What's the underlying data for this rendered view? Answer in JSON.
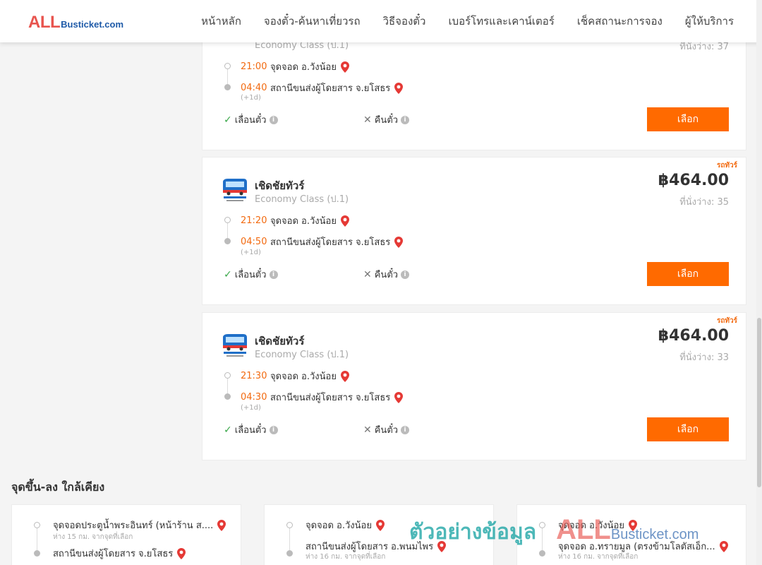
{
  "header": {
    "logo_all": "ALL",
    "logo_rest": "Busticket.com",
    "nav": [
      "หน้าหลัก",
      "จองตั๋ว-ค้นหาเที่ยวรถ",
      "วิธีจองตั๋ว",
      "เบอร์โทรและเคาน์เตอร์",
      "เช็คสถานะการจอง",
      "ผู้ให้บริการ"
    ]
  },
  "trips": [
    {
      "tag": "",
      "operator": "",
      "class": "Economy Class (ป.1)",
      "price": "",
      "seats": "ที่นั่งว่าง: 37",
      "depart_time": "21:00",
      "depart_place": "จุดจอด อ.วังน้อย",
      "arrive_time": "04:40",
      "arrive_place": "สถานีขนส่งผู้โดยสาร จ.ยโสธร",
      "plus_day": "(+1d)",
      "reschedule": "เลื่อนตั๋ว",
      "refund": "คืนตั๋ว",
      "select": "เลือก"
    },
    {
      "tag": "รถทัวร์",
      "operator": "เชิดชัยทัวร์",
      "class": "Economy Class (ป.1)",
      "price": "฿464.00",
      "seats": "ที่นั่งว่าง: 35",
      "depart_time": "21:20",
      "depart_place": "จุดจอด อ.วังน้อย",
      "arrive_time": "04:50",
      "arrive_place": "สถานีขนส่งผู้โดยสาร จ.ยโสธร",
      "plus_day": "(+1d)",
      "reschedule": "เลื่อนตั๋ว",
      "refund": "คืนตั๋ว",
      "select": "เลือก"
    },
    {
      "tag": "รถทัวร์",
      "operator": "เชิดชัยทัวร์",
      "class": "Economy Class (ป.1)",
      "price": "฿464.00",
      "seats": "ที่นั่งว่าง: 33",
      "depart_time": "21:30",
      "depart_place": "จุดจอด อ.วังน้อย",
      "arrive_time": "04:30",
      "arrive_place": "สถานีขนส่งผู้โดยสาร จ.ยโสธร",
      "plus_day": "(+1d)",
      "reschedule": "เลื่อนตั๋ว",
      "refund": "คืนตั๋ว",
      "select": "เลือก"
    }
  ],
  "info_glyph": "i",
  "nearby": {
    "title": "จุดขึ้น-ลง ใกล้เคียง",
    "cards": [
      {
        "from": "จุดจอดประตูน้ำพระอินทร์ (หน้าร้าน ส....",
        "from_sub": "ห่าง 15 กม. จากจุดที่เลือก",
        "to": "สถานีขนส่งผู้โดยสาร จ.ยโสธร",
        "to_sub": ""
      },
      {
        "from": "จุดจอด อ.วังน้อย",
        "from_sub": "",
        "to": "สถานีขนส่งผู้โดยสาร อ.พนมไพร",
        "to_sub": "ห่าง 16 กม. จากจุดที่เลือก"
      },
      {
        "from": "จุดจอด อ.วังน้อย",
        "from_sub": "",
        "to": "จุดจอด อ.ทรายมูล (ตรงข้ามโลตัสเอ็ก...",
        "to_sub": "ห่าง 16 กม. จากจุดที่เลือก"
      }
    ]
  },
  "watermark": {
    "thai": "ตัวอย่างข้อมูล",
    "all": "ALL",
    "rest": "Busticket.com"
  },
  "colors": {
    "accent": "#ff6a00",
    "time": "#f26a10",
    "pin": "#e53935",
    "logo_red": "#e8544e",
    "logo_blue": "#1e5aa8"
  }
}
